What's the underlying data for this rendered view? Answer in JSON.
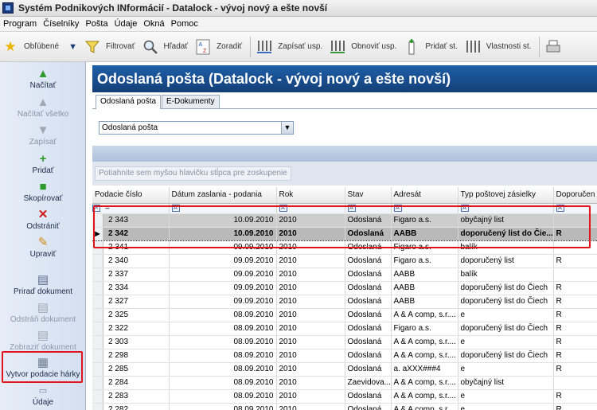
{
  "window": {
    "title": "Systém Podnikových INformácií - Datalock - vývoj nový a ešte novší"
  },
  "menu": [
    "Program",
    "Číselníky",
    "Pošta",
    "Údaje",
    "Okná",
    "Pomoc"
  ],
  "toolbar": {
    "favorites": "Obľúbené",
    "filter": "Filtrovať",
    "search": "Hľadať",
    "sort": "Zoradiť",
    "save_layout": "Zapísať usp.",
    "refresh_layout": "Obnoviť usp.",
    "add_st": "Pridať st.",
    "props_st": "Vlastnosti st."
  },
  "sidebar": [
    {
      "label": "Načítať",
      "enabled": true
    },
    {
      "label": "Načítať všetko",
      "enabled": false
    },
    {
      "label": "Zapísať",
      "enabled": false
    },
    {
      "label": "Pridať",
      "enabled": true
    },
    {
      "label": "Skopírovať",
      "enabled": true
    },
    {
      "label": "Odstrániť",
      "enabled": true
    },
    {
      "label": "Upraviť",
      "enabled": true
    },
    {
      "label": "Priraď dokument",
      "enabled": true
    },
    {
      "label": "Odstráň dokument",
      "enabled": false
    },
    {
      "label": "Zobraziť dokument",
      "enabled": false
    },
    {
      "label": "Vytvor podacie hárky",
      "enabled": true
    },
    {
      "label": "Údaje",
      "enabled": true
    }
  ],
  "header": {
    "title": "Odoslaná pošta (Datalock - vývoj nový a ešte novší)"
  },
  "tabs": [
    "Odoslaná pošta",
    "E-Dokumenty"
  ],
  "combo": {
    "value": "Odoslaná pošta"
  },
  "grid": {
    "group_hint": "Potiahnite sem myšou hlavičku stĺpca pre zoskupenie",
    "columns": [
      "Podacie číslo",
      "Dátum zaslania - podania",
      "Rok",
      "Stav",
      "Adresát",
      "Typ poštovej zásielky",
      "Doporučen"
    ],
    "filter_eq": "=",
    "rows": [
      [
        "2 343",
        "10.09.2010",
        "2010",
        "Odoslaná",
        "Figaro a.s.",
        "obyčajný list",
        ""
      ],
      [
        "2 342",
        "10.09.2010",
        "2010",
        "Odoslaná",
        "AABB",
        "doporučený list do Čie...",
        "R"
      ],
      [
        "2 341",
        "09.09.2010",
        "2010",
        "Odoslaná",
        "Figaro a.s.",
        "balík",
        ""
      ],
      [
        "2 340",
        "09.09.2010",
        "2010",
        "Odoslaná",
        "Figaro a.s.",
        "doporučený list",
        "R"
      ],
      [
        "2 337",
        "09.09.2010",
        "2010",
        "Odoslaná",
        "AABB",
        "balík",
        ""
      ],
      [
        "2 334",
        "09.09.2010",
        "2010",
        "Odoslaná",
        "AABB",
        "doporučený list do Čiech",
        "R"
      ],
      [
        "2 327",
        "09.09.2010",
        "2010",
        "Odoslaná",
        "AABB",
        "doporučený list do Čiech",
        "R"
      ],
      [
        "2 325",
        "08.09.2010",
        "2010",
        "Odoslaná",
        "A & A comp, s.r....",
        "e",
        "R"
      ],
      [
        "2 322",
        "08.09.2010",
        "2010",
        "Odoslaná",
        "Figaro a.s.",
        "doporučený list do Čiech",
        "R"
      ],
      [
        "2 303",
        "08.09.2010",
        "2010",
        "Odoslaná",
        "A & A comp, s.r....",
        "e",
        "R"
      ],
      [
        "2 298",
        "08.09.2010",
        "2010",
        "Odoslaná",
        "A & A comp, s.r....",
        "doporučený list do Čiech",
        "R"
      ],
      [
        "2 285",
        "08.09.2010",
        "2010",
        "Odoslaná",
        "a. aXXX###4",
        "e",
        "R"
      ],
      [
        "2 284",
        "08.09.2010",
        "2010",
        "Zaevidova...",
        "A & A comp, s.r....",
        "obyčajný list",
        ""
      ],
      [
        "2 283",
        "08.09.2010",
        "2010",
        "Odoslaná",
        "A & A comp, s.r....",
        "e",
        "R"
      ],
      [
        "2 282",
        "08.09.2010",
        "2010",
        "Odoslaná",
        "A & A comp, s.r....",
        "e",
        "R"
      ]
    ]
  },
  "colors": {
    "header_bg": "#1e5fa8",
    "highlight": "#e0151b"
  }
}
